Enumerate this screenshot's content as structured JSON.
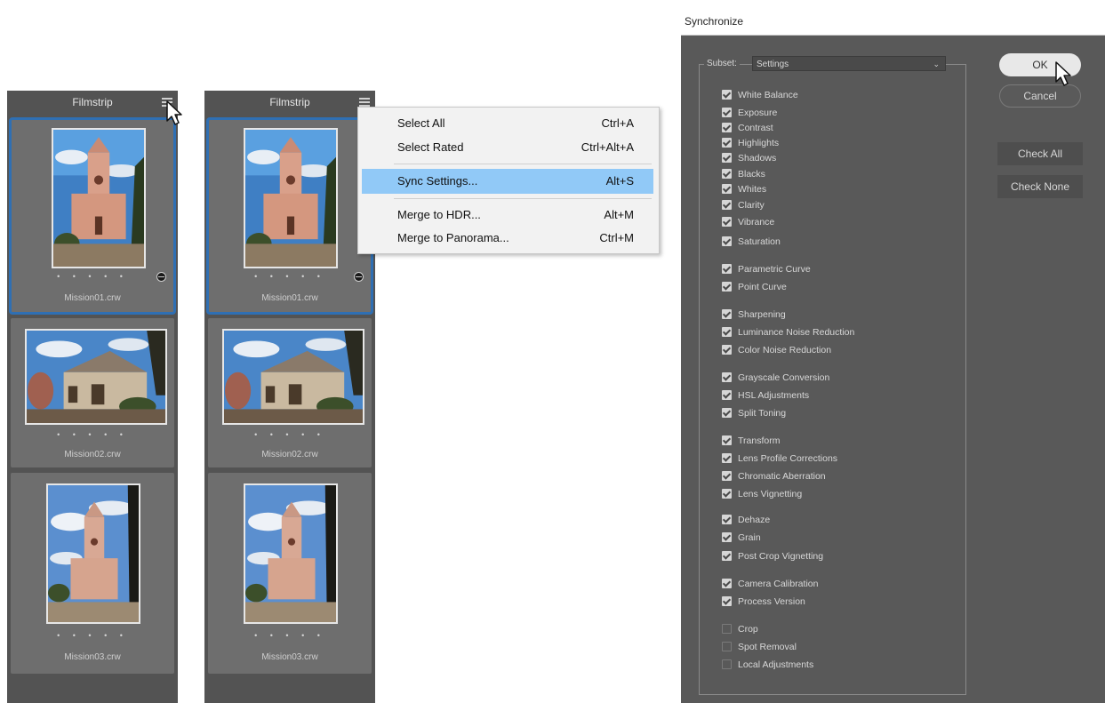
{
  "filmstrip_left": {
    "title": "Filmstrip",
    "items": [
      {
        "name": "Mission01.crw",
        "stars": "• • • • •"
      },
      {
        "name": "Mission02.crw",
        "stars": "• • • • •"
      },
      {
        "name": "Mission03.crw",
        "stars": "• • • • •"
      }
    ]
  },
  "filmstrip_right": {
    "title": "Filmstrip",
    "items": [
      {
        "name": "Mission01.crw",
        "stars": "• • • • •"
      },
      {
        "name": "Mission02.crw",
        "stars": "• • • • •"
      },
      {
        "name": "Mission03.crw",
        "stars": "• • • • •"
      }
    ]
  },
  "context_menu": {
    "items": [
      {
        "label": "Select All",
        "shortcut": "Ctrl+A"
      },
      {
        "label": "Select Rated",
        "shortcut": "Ctrl+Alt+A"
      },
      {
        "label": "Sync Settings...",
        "shortcut": "Alt+S",
        "highlighted": true
      },
      {
        "label": "Merge to HDR...",
        "shortcut": "Alt+M"
      },
      {
        "label": "Merge to Panorama...",
        "shortcut": "Ctrl+M"
      }
    ]
  },
  "sync_dialog": {
    "title": "Synchronize",
    "subset_label": "Subset:",
    "subset_value": "Settings",
    "checkboxes": [
      {
        "label": "White Balance",
        "checked": true
      },
      {
        "label": "Exposure",
        "checked": true
      },
      {
        "label": "Contrast",
        "checked": true
      },
      {
        "label": "Highlights",
        "checked": true
      },
      {
        "label": "Shadows",
        "checked": true
      },
      {
        "label": "Blacks",
        "checked": true
      },
      {
        "label": "Whites",
        "checked": true
      },
      {
        "label": "Clarity",
        "checked": true
      },
      {
        "label": "Vibrance",
        "checked": true
      },
      {
        "label": "Saturation",
        "checked": true
      },
      {
        "label": "Parametric Curve",
        "checked": true
      },
      {
        "label": "Point Curve",
        "checked": true
      },
      {
        "label": "Sharpening",
        "checked": true
      },
      {
        "label": "Luminance Noise Reduction",
        "checked": true
      },
      {
        "label": "Color Noise Reduction",
        "checked": true
      },
      {
        "label": "Grayscale Conversion",
        "checked": true
      },
      {
        "label": "HSL Adjustments",
        "checked": true
      },
      {
        "label": "Split Toning",
        "checked": true
      },
      {
        "label": "Transform",
        "checked": true
      },
      {
        "label": "Lens Profile Corrections",
        "checked": true
      },
      {
        "label": "Chromatic Aberration",
        "checked": true
      },
      {
        "label": "Lens Vignetting",
        "checked": true
      },
      {
        "label": "Dehaze",
        "checked": true
      },
      {
        "label": "Grain",
        "checked": true
      },
      {
        "label": "Post Crop Vignetting",
        "checked": true
      },
      {
        "label": "Camera Calibration",
        "checked": true
      },
      {
        "label": "Process Version",
        "checked": true
      },
      {
        "label": "Crop",
        "checked": false
      },
      {
        "label": "Spot Removal",
        "checked": false
      },
      {
        "label": "Local Adjustments",
        "checked": false
      }
    ],
    "buttons": {
      "ok": "OK",
      "cancel": "Cancel",
      "check_all": "Check All",
      "check_none": "Check None"
    }
  },
  "colors": {
    "selection_blue": "#2f6fb3",
    "menu_highlight": "#91c9f7",
    "panel_gray": "#535353",
    "dialog_gray": "#595959"
  }
}
